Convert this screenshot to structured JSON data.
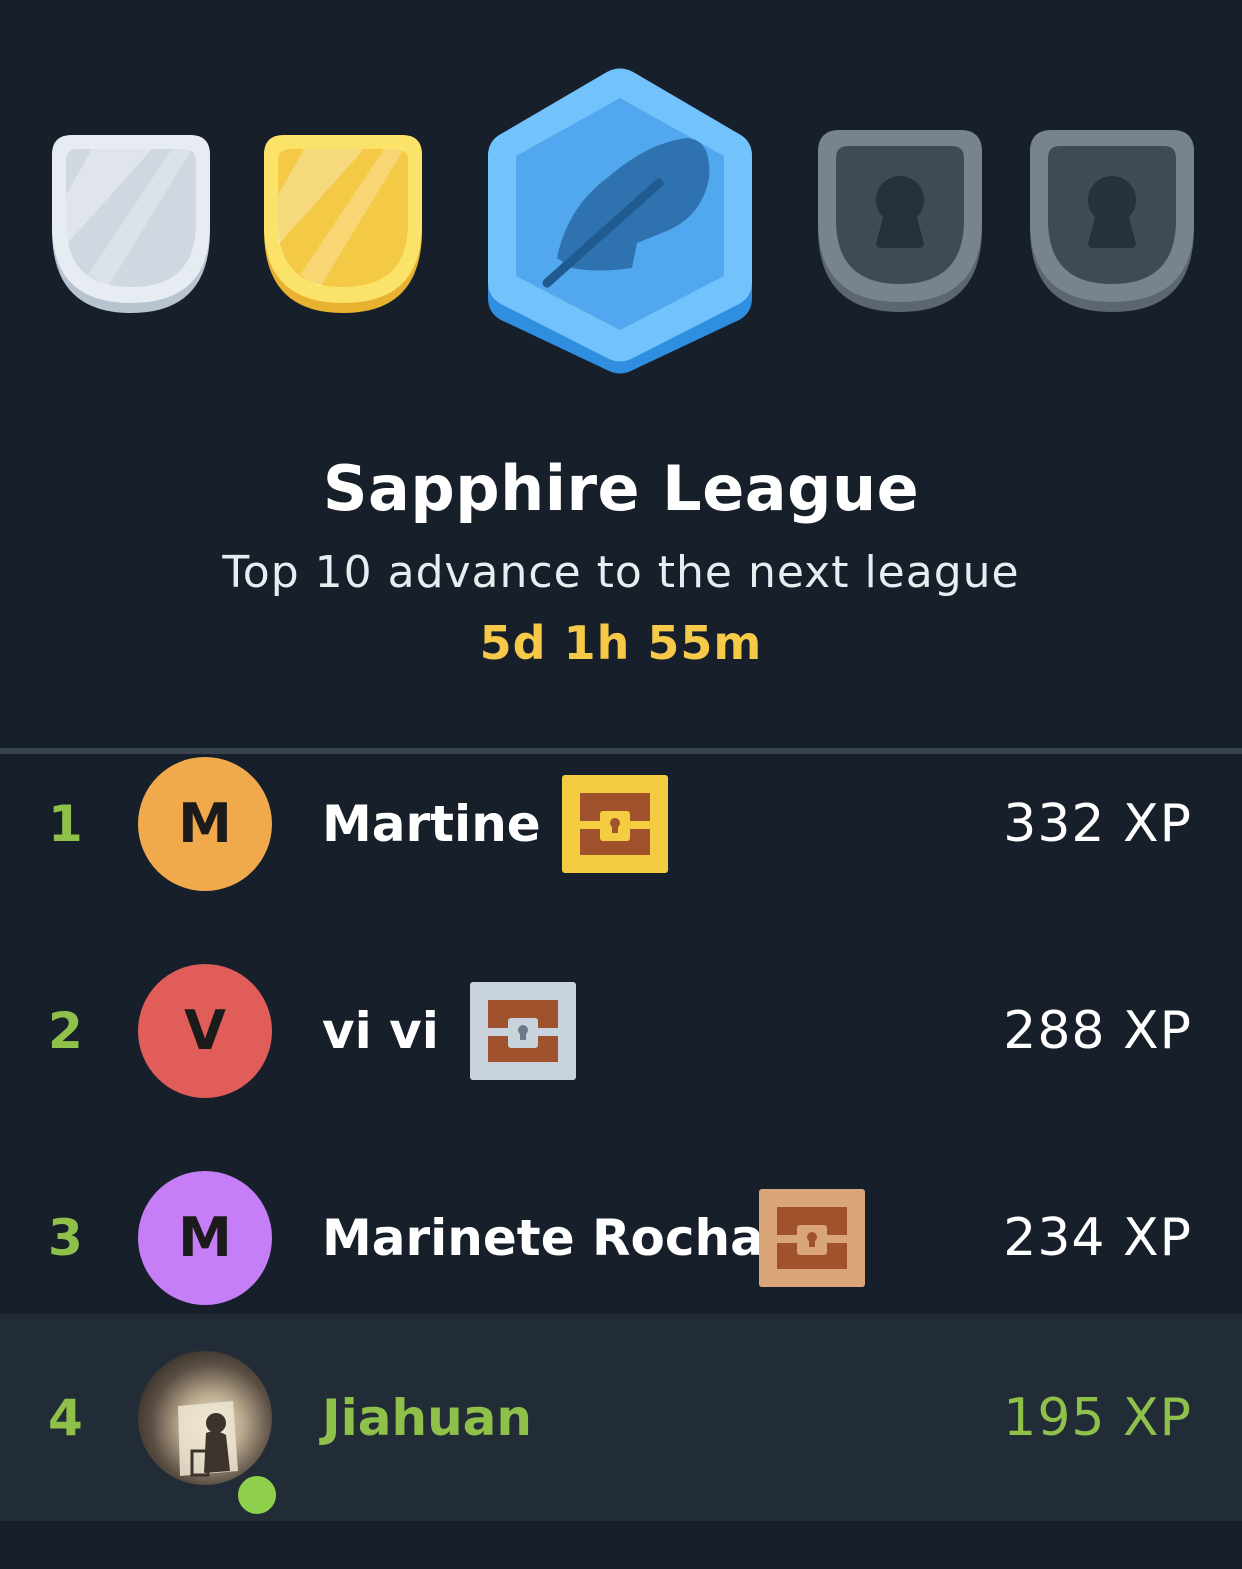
{
  "league": {
    "title": "Sapphire League",
    "subtitle": "Top 10 advance to the next league",
    "time_remaining": "5d 1h 55m"
  },
  "badges": [
    {
      "name": "silver",
      "state": "completed",
      "color": "#d4dde6",
      "icon": "shield-icon"
    },
    {
      "name": "gold",
      "state": "completed",
      "color": "#f5cf4a",
      "icon": "shield-icon"
    },
    {
      "name": "sapphire",
      "state": "current",
      "color": "#55aaf0",
      "icon": "feather-icon"
    },
    {
      "name": "locked-1",
      "state": "locked",
      "color": "#6b7880",
      "icon": "keyhole-icon"
    },
    {
      "name": "locked-2",
      "state": "locked",
      "color": "#6b7880",
      "icon": "keyhole-icon"
    }
  ],
  "leaderboard": [
    {
      "rank": "1",
      "initial": "M",
      "avatar_color": "#f0a94b",
      "name": "Martine",
      "chest": "gold-chest-icon",
      "xp": "332 XP"
    },
    {
      "rank": "2",
      "initial": "V",
      "avatar_color": "#e05d5a",
      "name": "vi vi",
      "chest": "silver-chest-icon",
      "xp": "288 XP"
    },
    {
      "rank": "3",
      "initial": "M",
      "avatar_color": "#c57ef5",
      "name": "Marinete Rocha",
      "chest": "bronze-chest-icon",
      "xp": "234 XP"
    },
    {
      "rank": "4",
      "initial": "",
      "avatar_color": "",
      "name": "Jiahuan",
      "chest": "",
      "xp": "195 XP",
      "is_current_user": true,
      "online": true
    }
  ],
  "colors": {
    "background": "#17202a",
    "highlight_row": "#222c36",
    "accent_green": "#8fc14a",
    "timer_yellow": "#f7c948"
  }
}
